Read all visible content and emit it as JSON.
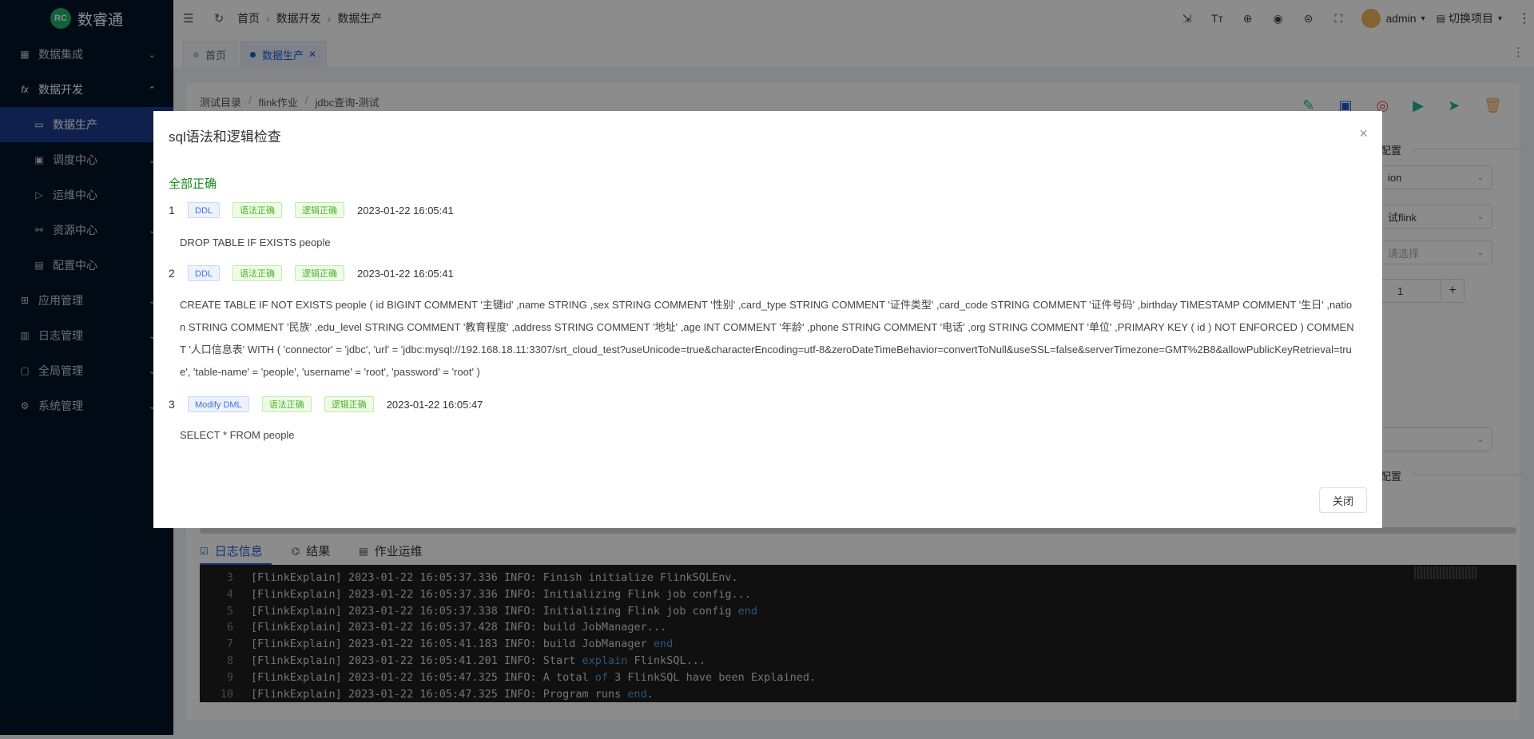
{
  "sidebar": {
    "brand": "数睿通",
    "brand_badge": "RC",
    "items": [
      {
        "label": "数据集成",
        "icon": "grid-icon",
        "arrow": "⌄"
      },
      {
        "label": "数据开发",
        "icon": "function-icon",
        "arrow": "⌃"
      },
      {
        "label": "数据生产",
        "icon": "monitor-icon"
      },
      {
        "label": "调度中心",
        "icon": "calendar-icon",
        "arrow": "⌄"
      },
      {
        "label": "运维中心",
        "icon": "send-icon"
      },
      {
        "label": "资源中心",
        "icon": "share-icon",
        "arrow": "⌄"
      },
      {
        "label": "配置中心",
        "icon": "config-icon"
      },
      {
        "label": "应用管理",
        "icon": "apps-icon",
        "arrow": "⌄"
      },
      {
        "label": "日志管理",
        "icon": "log-icon",
        "arrow": "⌄"
      },
      {
        "label": "全局管理",
        "icon": "global-icon",
        "arrow": "⌄"
      },
      {
        "label": "系统管理",
        "icon": "gear-icon",
        "arrow": "⌄"
      }
    ]
  },
  "header": {
    "breadcrumb": [
      "首页",
      "数据开发",
      "数据生产"
    ],
    "user": "admin",
    "switch_project": "切换项目"
  },
  "tabs": [
    {
      "label": "首页"
    },
    {
      "label": "数据生产",
      "close": "✕"
    }
  ],
  "editor": {
    "path": [
      "测试目录",
      "flink作业",
      "jdbc查询-测试"
    ]
  },
  "right_panel": {
    "config_title_1": "配置",
    "select_1": "ion",
    "select_2": "试flink",
    "select_3": "请选择",
    "parallelism": "1",
    "plus": "+",
    "config_title_2": "配置"
  },
  "bottom_tabs": [
    {
      "label": "日志信息"
    },
    {
      "label": "结果"
    },
    {
      "label": "作业运维"
    }
  ],
  "console": {
    "lines": [
      {
        "num": "3",
        "pre": "[FlinkExplain] 2023-01-22 16:05:37.336 INFO: Finish initialize FlinkSQLEnv.",
        "kw": "",
        "post": ""
      },
      {
        "num": "4",
        "pre": "[FlinkExplain] 2023-01-22 16:05:37.336 INFO: Initializing Flink job config...",
        "kw": "",
        "post": ""
      },
      {
        "num": "5",
        "pre": "[FlinkExplain] 2023-01-22 16:05:37.338 INFO: Initializing Flink job config ",
        "kw": "end",
        "post": ""
      },
      {
        "num": "6",
        "pre": "[FlinkExplain] 2023-01-22 16:05:37.428 INFO: build JobManager...",
        "kw": "",
        "post": ""
      },
      {
        "num": "7",
        "pre": "[FlinkExplain] 2023-01-22 16:05:41.183 INFO: build JobManager ",
        "kw": "end",
        "post": ""
      },
      {
        "num": "8",
        "pre": "[FlinkExplain] 2023-01-22 16:05:41.201 INFO: Start ",
        "kw": "explain",
        "post": " FlinkSQL..."
      },
      {
        "num": "9",
        "pre": "[FlinkExplain] 2023-01-22 16:05:47.325 INFO: A total ",
        "kw": "of",
        "post": " 3 FlinkSQL have been Explained."
      },
      {
        "num": "10",
        "pre": "[FlinkExplain] 2023-01-22 16:05:47.325 INFO: Program runs ",
        "kw": "end",
        "post": "."
      }
    ]
  },
  "modal": {
    "title": "sql语法和逻辑检查",
    "close_icon": "×",
    "summary": "全部正确",
    "items": [
      {
        "index": "1",
        "type": "DDL",
        "syntax": "语法正确",
        "logic": "逻辑正确",
        "time": "2023-01-22 16:05:41",
        "sql": "DROP TABLE IF EXISTS people"
      },
      {
        "index": "2",
        "type": "DDL",
        "syntax": "语法正确",
        "logic": "逻辑正确",
        "time": "2023-01-22 16:05:41",
        "sql": "CREATE TABLE IF NOT EXISTS people ( id BIGINT COMMENT '主键id' ,name STRING ,sex STRING COMMENT '性别' ,card_type STRING COMMENT '证件类型' ,card_code STRING COMMENT '证件号码' ,birthday TIMESTAMP COMMENT '生日' ,nation STRING COMMENT '民族' ,edu_level STRING COMMENT '教育程度' ,address STRING COMMENT '地址' ,age INT COMMENT '年龄' ,phone STRING COMMENT '电话' ,org STRING COMMENT '单位' ,PRIMARY KEY ( id ) NOT ENFORCED ) COMMENT '人口信息表' WITH ( 'connector' = 'jdbc', 'url' = 'jdbc:mysql://192.168.18.11:3307/srt_cloud_test?useUnicode=true&characterEncoding=utf-8&zeroDateTimeBehavior=convertToNull&useSSL=false&serverTimezone=GMT%2B8&allowPublicKeyRetrieval=true', 'table-name' = 'people', 'username' = 'root', 'password' = 'root' )"
      },
      {
        "index": "3",
        "type": "Modify DML",
        "syntax": "语法正确",
        "logic": "逻辑正确",
        "time": "2023-01-22 16:05:47",
        "sql": "SELECT * FROM people"
      }
    ],
    "close_button": "关闭"
  }
}
